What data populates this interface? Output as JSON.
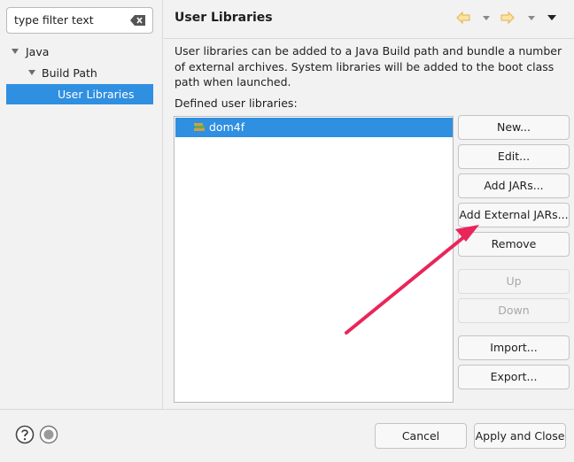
{
  "filter": {
    "placeholder": "type filter text"
  },
  "tree": {
    "items": [
      {
        "label": "Java",
        "expanded": true
      },
      {
        "label": "Build Path",
        "expanded": true
      },
      {
        "label": "User Libraries",
        "selected": true
      }
    ]
  },
  "header": {
    "title": "User Libraries",
    "icons": [
      "back-icon",
      "back-menu-icon",
      "forward-icon",
      "forward-menu-icon",
      "view-menu-icon"
    ]
  },
  "main": {
    "description": "User libraries can be added to a Java Build path and bundle a number of external archives. System libraries will be added to the boot class path when launched.",
    "defined_label": "Defined user libraries:",
    "libraries": [
      {
        "name": "dom4f",
        "icon": "library-icon",
        "selected": true
      }
    ],
    "buttons": {
      "new": "New...",
      "edit": "Edit...",
      "add_jars": "Add JARs...",
      "add_external_jars": "Add External JARs...",
      "remove": "Remove",
      "up": "Up",
      "down": "Down",
      "import": "Import...",
      "export": "Export..."
    },
    "disabled_buttons": [
      "up",
      "down"
    ]
  },
  "footer": {
    "icons": [
      "help-icon",
      "record-icon"
    ],
    "cancel": "Cancel",
    "apply_close": "Apply and Close"
  },
  "colors": {
    "selection": "#2f8fe0",
    "annotation_arrow": "#e8265a",
    "nav_arrow": "#f0c060"
  }
}
